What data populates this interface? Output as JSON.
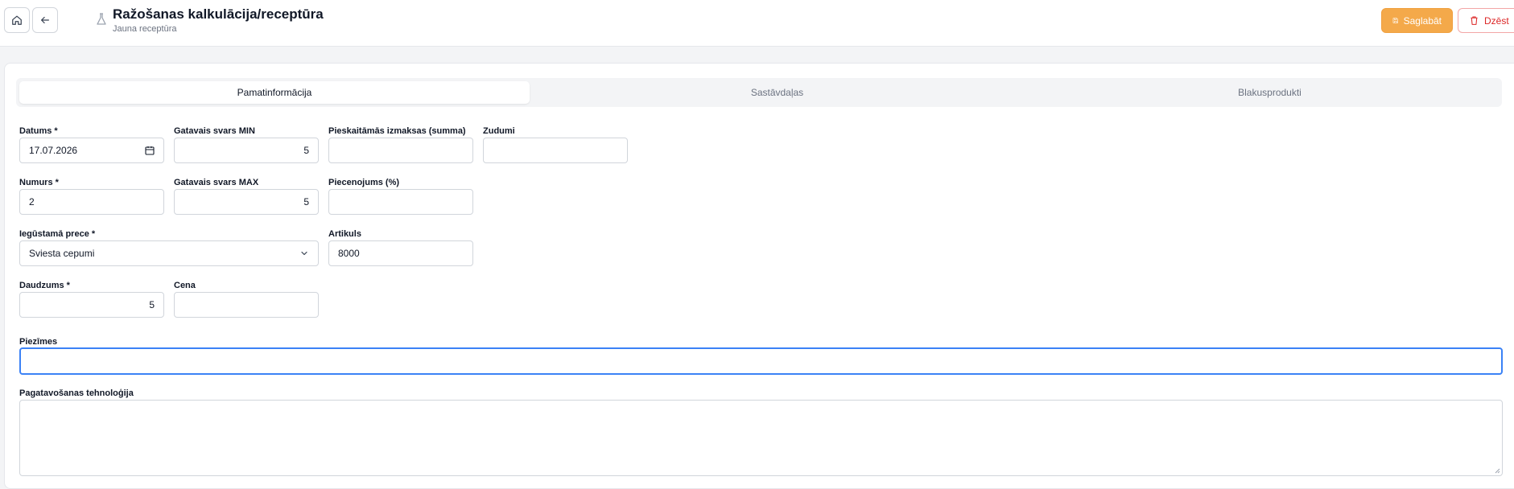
{
  "header": {
    "title": "Ražošanas kalkulācija/receptūra",
    "subtitle": "Jauna receptūra",
    "home_icon": "home-icon",
    "back_icon": "arrow-left-icon",
    "title_icon": "flask-icon",
    "save_label": "Saglabāt",
    "delete_label": "Dzēst"
  },
  "tabs": [
    {
      "label": "Pamatinformācija",
      "active": true
    },
    {
      "label": "Sastāvdaļas",
      "active": false
    },
    {
      "label": "Blakusprodukti",
      "active": false
    }
  ],
  "form": {
    "datums": {
      "label": "Datums *",
      "value": "17.07.2026"
    },
    "svars_min": {
      "label": "Gatavais svars MIN",
      "value": "5"
    },
    "izmaksas": {
      "label": "Pieskaitāmās izmaksas (summa)",
      "value": ""
    },
    "zudumi": {
      "label": "Zudumi",
      "value": ""
    },
    "numurs": {
      "label": "Numurs *",
      "value": "2"
    },
    "svars_max": {
      "label": "Gatavais svars MAX",
      "value": "5"
    },
    "piecenojums": {
      "label": "Piecenojums (%)",
      "value": ""
    },
    "prece": {
      "label": "Iegūstamā prece *",
      "value": "Sviesta cepumi"
    },
    "artikuls": {
      "label": "Artikuls",
      "value": "8000"
    },
    "daudzums": {
      "label": "Daudzums *",
      "value": "5"
    },
    "cena": {
      "label": "Cena",
      "value": ""
    },
    "piezimes": {
      "label": "Piezīmes",
      "value": ""
    },
    "tehnologija": {
      "label": "Pagatavošanas tehnoloģija",
      "value": ""
    }
  },
  "colors": {
    "accent": "#f4a94a",
    "danger": "#dc2626",
    "focus": "#3b82f6"
  }
}
